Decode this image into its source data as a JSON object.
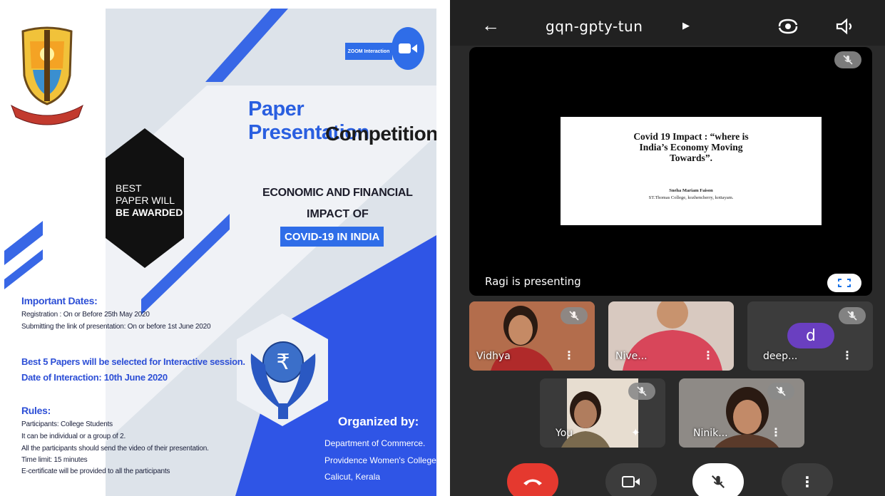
{
  "poster": {
    "zoom_label": "ZOOM Interaction",
    "title_line1": "Paper Presentation",
    "title_line2": "Competition",
    "award_line1": "BEST",
    "award_line2": "PAPER WILL",
    "award_line3": "BE AWARDED",
    "topic_line1": "ECONOMIC AND FINANCIAL",
    "topic_line2": "IMPACT OF",
    "topic_line3": "COVID-19 IN INDIA",
    "important_dates_heading": "Important Dates:",
    "registration": "Registration : On or Before 25th May 2020",
    "submission": "Submitting  the link of presentation: On or before 1st June 2020",
    "best_papers": "Best 5 Papers  will be selected for Interactive session.",
    "interaction_date": "Date of Interaction: 10th June 2020",
    "rules_heading": "Rules:",
    "rules": [
      "Participants: College Students",
      "It can be individual or a group of 2.",
      "All the participants should send the video of their presentation.",
      "Time limit: 15 minutes",
      "E-certificate will be provided to all the participants"
    ],
    "organized_heading": "Organized by:",
    "org_lines": [
      "Department of Commerce.",
      "Providence Women's College",
      "Calicut, Kerala"
    ],
    "colors": {
      "blue": "#2f6de8",
      "dark": "#1b1b1b",
      "panel": "#dde3ea"
    }
  },
  "meet": {
    "room_code": "gqn-gpty-tun",
    "slide_title_line1": "Covid 19 Impact : “where is",
    "slide_title_line2": "India’s Economy Moving",
    "slide_title_line3": "Towards”.",
    "slide_author": "Sneha Mariam Faison",
    "slide_institution": "ST.Thomas College, kozhencherry, kottayam.",
    "presenting_label": "Ragi is presenting",
    "participants": [
      {
        "name": "Vidhya"
      },
      {
        "name": "Nive..."
      },
      {
        "name": "deep...",
        "avatar_letter": "d"
      },
      {
        "name": "You"
      },
      {
        "name": "Ninik..."
      }
    ],
    "colors": {
      "end_call": "#e5392f",
      "avatar": "#6a3fc0",
      "control_bg": "#3c3c3c"
    }
  }
}
